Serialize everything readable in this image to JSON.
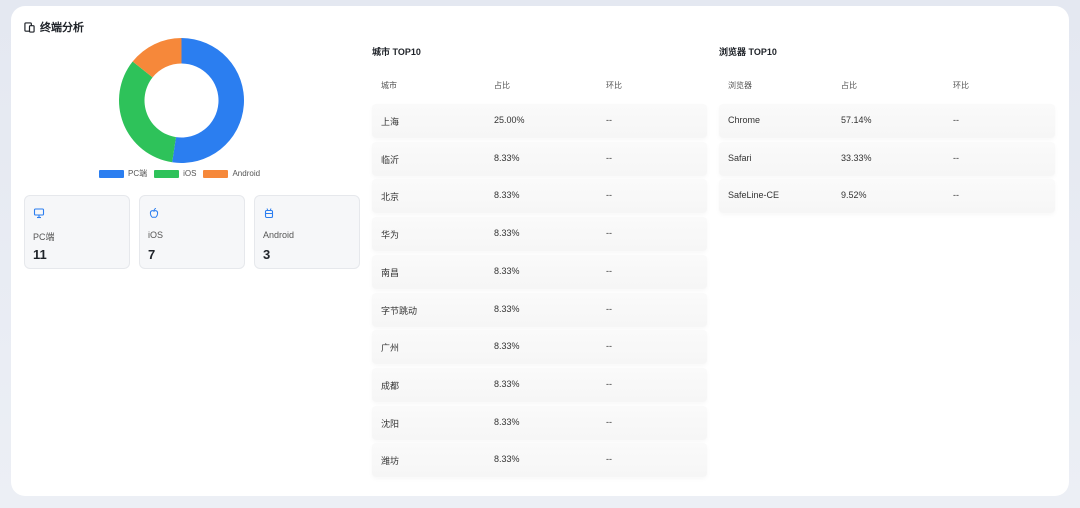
{
  "section": {
    "title": "终端分析"
  },
  "chart_data": {
    "type": "pie",
    "categories": [
      "PC端",
      "iOS",
      "Android"
    ],
    "values": [
      11,
      7,
      3
    ],
    "colors": [
      "#2b7ef0",
      "#2ec25a",
      "#f6883a"
    ],
    "legend_position": "bottom"
  },
  "stats": [
    {
      "icon": "monitor-icon",
      "label": "PC端",
      "value": "11",
      "color": "#2b7ef0"
    },
    {
      "icon": "apple-icon",
      "label": "iOS",
      "value": "7",
      "color": "#2b7ef0"
    },
    {
      "icon": "android-icon",
      "label": "Android",
      "value": "3",
      "color": "#2b7ef0"
    }
  ],
  "city": {
    "title": "城市 TOP10",
    "headers": [
      "城市",
      "占比",
      "环比"
    ],
    "rows": [
      [
        "上海",
        "25.00%",
        "--"
      ],
      [
        "临沂",
        "8.33%",
        "--"
      ],
      [
        "北京",
        "8.33%",
        "--"
      ],
      [
        "华为",
        "8.33%",
        "--"
      ],
      [
        "南昌",
        "8.33%",
        "--"
      ],
      [
        "字节跳动",
        "8.33%",
        "--"
      ],
      [
        "广州",
        "8.33%",
        "--"
      ],
      [
        "成都",
        "8.33%",
        "--"
      ],
      [
        "沈阳",
        "8.33%",
        "--"
      ],
      [
        "潍坊",
        "8.33%",
        "--"
      ]
    ]
  },
  "browser": {
    "title": "浏览器 TOP10",
    "headers": [
      "浏览器",
      "占比",
      "环比"
    ],
    "rows": [
      [
        "Chrome",
        "57.14%",
        "--"
      ],
      [
        "Safari",
        "33.33%",
        "--"
      ],
      [
        "SafeLine-CE",
        "9.52%",
        "--"
      ]
    ]
  }
}
